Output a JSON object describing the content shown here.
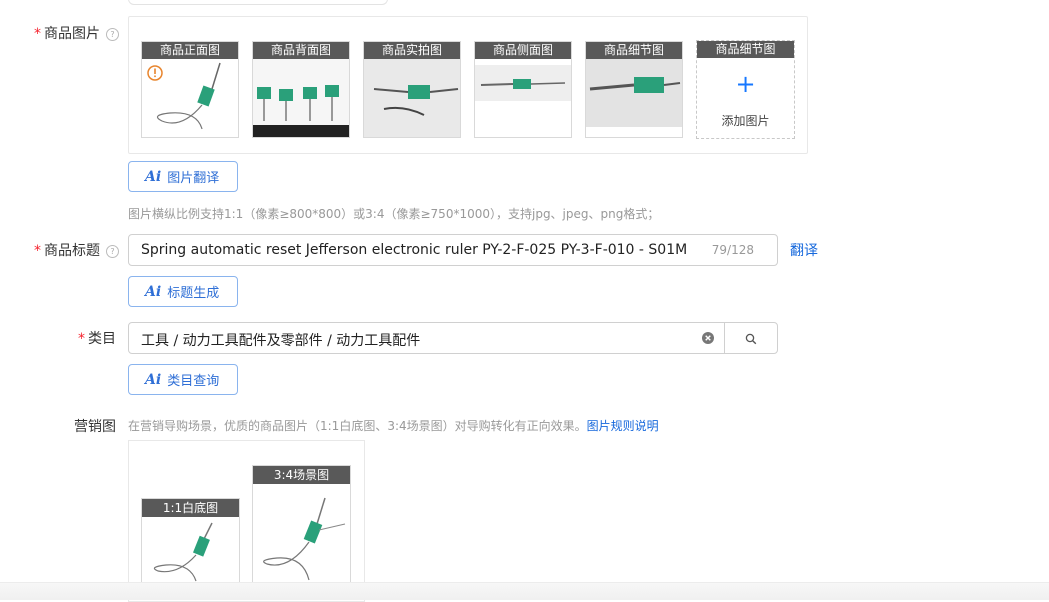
{
  "product_images": {
    "label": "商品图片",
    "required_mark": "*",
    "help_icon": "question-circle-icon",
    "warning_icon": "exclamation-circle-icon",
    "tiles": [
      {
        "caption": "商品正面图"
      },
      {
        "caption": "商品背面图"
      },
      {
        "caption": "商品实拍图"
      },
      {
        "caption": "商品侧面图"
      },
      {
        "caption": "商品细节图"
      }
    ],
    "add_tile": {
      "caption": "商品细节图",
      "plus": "+",
      "text": "添加图片"
    },
    "translate_button": "图片翻译",
    "hint": "图片横纵比例支持1:1（像素≥800*800）或3:4（像素≥750*1000），支持jpg、jpeg、png格式；"
  },
  "product_title": {
    "label": "商品标题",
    "required_mark": "*",
    "value": "Spring automatic reset  Jefferson electronic ruler PY-2-F-025 PY-3-F-010 - S01M",
    "counter": "79/128",
    "translate_link": "翻译",
    "generate_button": "标题生成"
  },
  "category": {
    "label": "类目",
    "required_mark": "*",
    "value": "工具 / 动力工具配件及零部件 / 动力工具配件",
    "clear_icon": "clear-circle-icon",
    "search_icon": "search-icon",
    "query_button": "类目查询"
  },
  "marketing": {
    "label": "营销图",
    "hint": "在营销导购场景，优质的商品图片（1:1白底图、3:4场景图）对导购转化有正向效果。",
    "rules_link": "图片规则说明",
    "tiles": [
      {
        "caption": "1:1白底图"
      },
      {
        "caption": "3:4场景图"
      }
    ]
  },
  "ai_badge": "Ai",
  "colors": {
    "accent": "#1677ff",
    "required": "#f5222d",
    "caption_bg": "#595959"
  }
}
